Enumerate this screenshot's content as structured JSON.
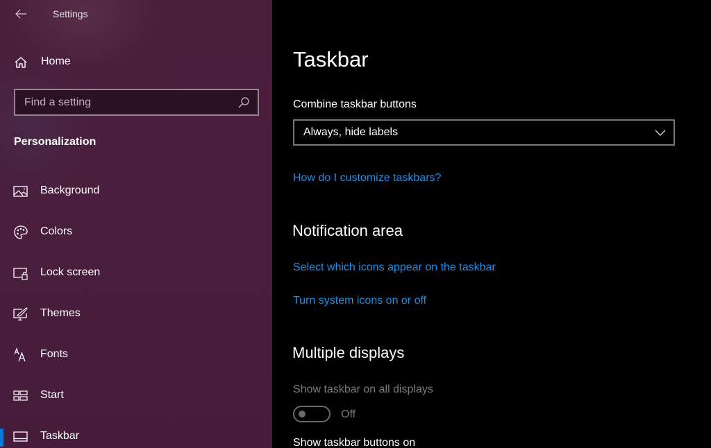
{
  "window": {
    "app_title": "Settings",
    "back_icon": "arrow-left-icon"
  },
  "sidebar": {
    "home": {
      "label": "Home",
      "icon": "home-icon"
    },
    "search": {
      "placeholder": "Find a setting",
      "value": "",
      "icon": "search-icon"
    },
    "section_title": "Personalization",
    "items": [
      {
        "label": "Background",
        "icon": "picture-icon",
        "active": false
      },
      {
        "label": "Colors",
        "icon": "palette-icon",
        "active": false
      },
      {
        "label": "Lock screen",
        "icon": "lock-screen-icon",
        "active": false
      },
      {
        "label": "Themes",
        "icon": "themes-icon",
        "active": false
      },
      {
        "label": "Fonts",
        "icon": "fonts-icon",
        "active": false
      },
      {
        "label": "Start",
        "icon": "start-icon",
        "active": false
      },
      {
        "label": "Taskbar",
        "icon": "taskbar-icon",
        "active": true
      }
    ],
    "accent_color": "#0a78d7"
  },
  "main": {
    "title": "Taskbar",
    "combine": {
      "label": "Combine taskbar buttons",
      "selected": "Always, hide labels"
    },
    "help_link": "How do I customize taskbars?",
    "notification_area": {
      "heading": "Notification area",
      "links": [
        "Select which icons appear on the taskbar",
        "Turn system icons on or off"
      ]
    },
    "multiple_displays": {
      "heading": "Multiple displays",
      "show_all_label": "Show taskbar on all displays",
      "show_all_state": "Off",
      "show_all_on": false,
      "show_buttons_label": "Show taskbar buttons on"
    },
    "link_color": "#1f8ee8"
  }
}
